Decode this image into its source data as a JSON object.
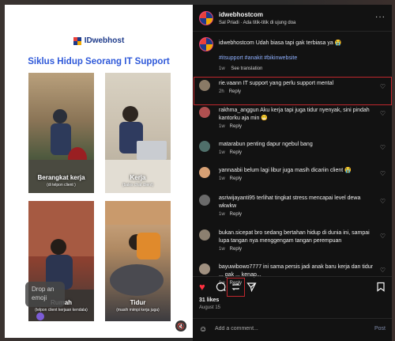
{
  "post": {
    "brand": "IDwebhost",
    "title": "Siklus Hidup Seorang IT Support",
    "photos": [
      {
        "caption": "Berangkat kerja",
        "sub": "(di telpon client )"
      },
      {
        "caption": "Kerja",
        "sub": "(bales chat client)"
      },
      {
        "caption": "Rumah",
        "sub": "(telpon client kerjaan kendala)"
      },
      {
        "caption": "Tidur",
        "sub": "(masih mimpi kerja juga)"
      }
    ],
    "drop_emoji": "Drop an emoji",
    "mute_icon": "speaker-muted-icon"
  },
  "header": {
    "username": "idwebhostcom",
    "subtitle": "Sal Priadi · Ada titik-titik di ujung doa",
    "more": "···"
  },
  "caption": {
    "username": "idwebhostcom",
    "text": "Udah biasa tapi gak terbiasa ya 😭",
    "tags": "#itsupport #anakit #bikinwebsite",
    "time": "1w",
    "see_translation": "See translation"
  },
  "comments": [
    {
      "text": "rie.vaann IT support yang perlu support mental",
      "time": "2h",
      "reply": "Reply",
      "color": "#8a7a66"
    },
    {
      "text": "rakhma_anggun Aku kerja tapi juga tidur nyenyak, sini pindah kantorku aja min 😁",
      "time": "1w",
      "reply": "Reply",
      "color": "#b05050"
    },
    {
      "text": "matarabun penting dapur ngebul bang",
      "time": "1w",
      "reply": "Reply",
      "color": "#4f6f6a"
    },
    {
      "text": "yannaabii belum lagi libur juga masih dicariin client 😭",
      "time": "1w",
      "reply": "Reply",
      "color": "#d7a074"
    },
    {
      "text": "asriwijayanti95 terlihat tingkat stress mencapai level dewa wkwkw",
      "time": "1w",
      "reply": "Reply",
      "color": "#6a6a6a"
    },
    {
      "text": "bukan.sicepat bro sedang bertahan hidup di dunia ini, sampai lupa tangan nya menggengam tangan perempuan",
      "time": "1w",
      "reply": "Reply",
      "color": "#8c8070"
    },
    {
      "text": "bayuwibowo7777 ini sama persis jadi anak baru kerja dan tidur ... gak ... kenap...",
      "time": "1w",
      "reply": "Reply",
      "color": "#a09080"
    }
  ],
  "actions": {
    "likes": "31 likes",
    "date": "August 15"
  },
  "add_comment": {
    "placeholder": "Add a comment...",
    "post": "Post"
  }
}
